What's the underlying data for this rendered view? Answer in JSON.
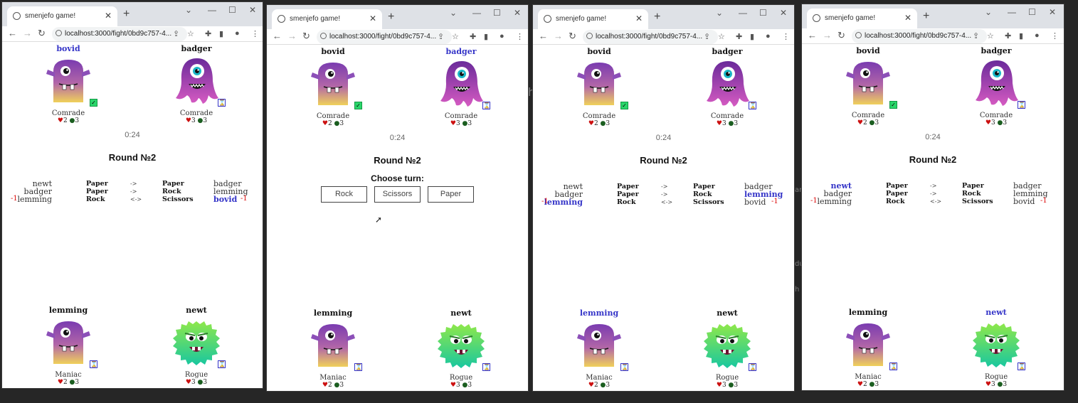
{
  "browser": {
    "tab_title": "smenjefo game!",
    "url": "localhost:3000/fight/0bd9c757-4...",
    "new_tab": "+",
    "tab_close": "✕",
    "minimize": "⌄",
    "min": "—",
    "max": "☐",
    "close": "✕"
  },
  "colors": {
    "highlight": "#3535c8",
    "ready": "#2bd66b",
    "heart": "#cc1111",
    "leaf": "#1b5e20"
  },
  "symbols": {
    "ready": "✓",
    "waiting": "⌛",
    "heart": "♥",
    "leaf": "●"
  },
  "game": {
    "timer": "0:24",
    "round": "Round №2",
    "choose_turn": "Choose turn:",
    "buttons": [
      "Rock",
      "Scissors",
      "Paper"
    ],
    "players": {
      "bovid": {
        "name": "bovid",
        "role": "Comrade",
        "hp": "2",
        "energy": "3"
      },
      "badger": {
        "name": "badger",
        "role": "Comrade",
        "hp": "3",
        "energy": "3"
      },
      "lemming": {
        "name": "lemming",
        "role": "Maniac",
        "hp": "2",
        "energy": "3"
      },
      "newt": {
        "name": "newt",
        "role": "Rogue",
        "hp": "3",
        "energy": "3"
      }
    },
    "results": [
      {
        "left": "newt",
        "move_l": "Paper",
        "arrow": "->",
        "move_r": "Paper",
        "right": "badger"
      },
      {
        "left": "badger",
        "move_l": "Paper",
        "arrow": "->",
        "move_r": "Rock",
        "right": "lemming"
      },
      {
        "left": "lemming",
        "move_l": "Rock",
        "arrow": "<->",
        "move_r": "Scissors",
        "right": "bovid"
      }
    ],
    "penalty": "-1"
  },
  "background": {
    "t1": "h",
    "t2": "an",
    "t3": "du",
    "t4": "h"
  }
}
